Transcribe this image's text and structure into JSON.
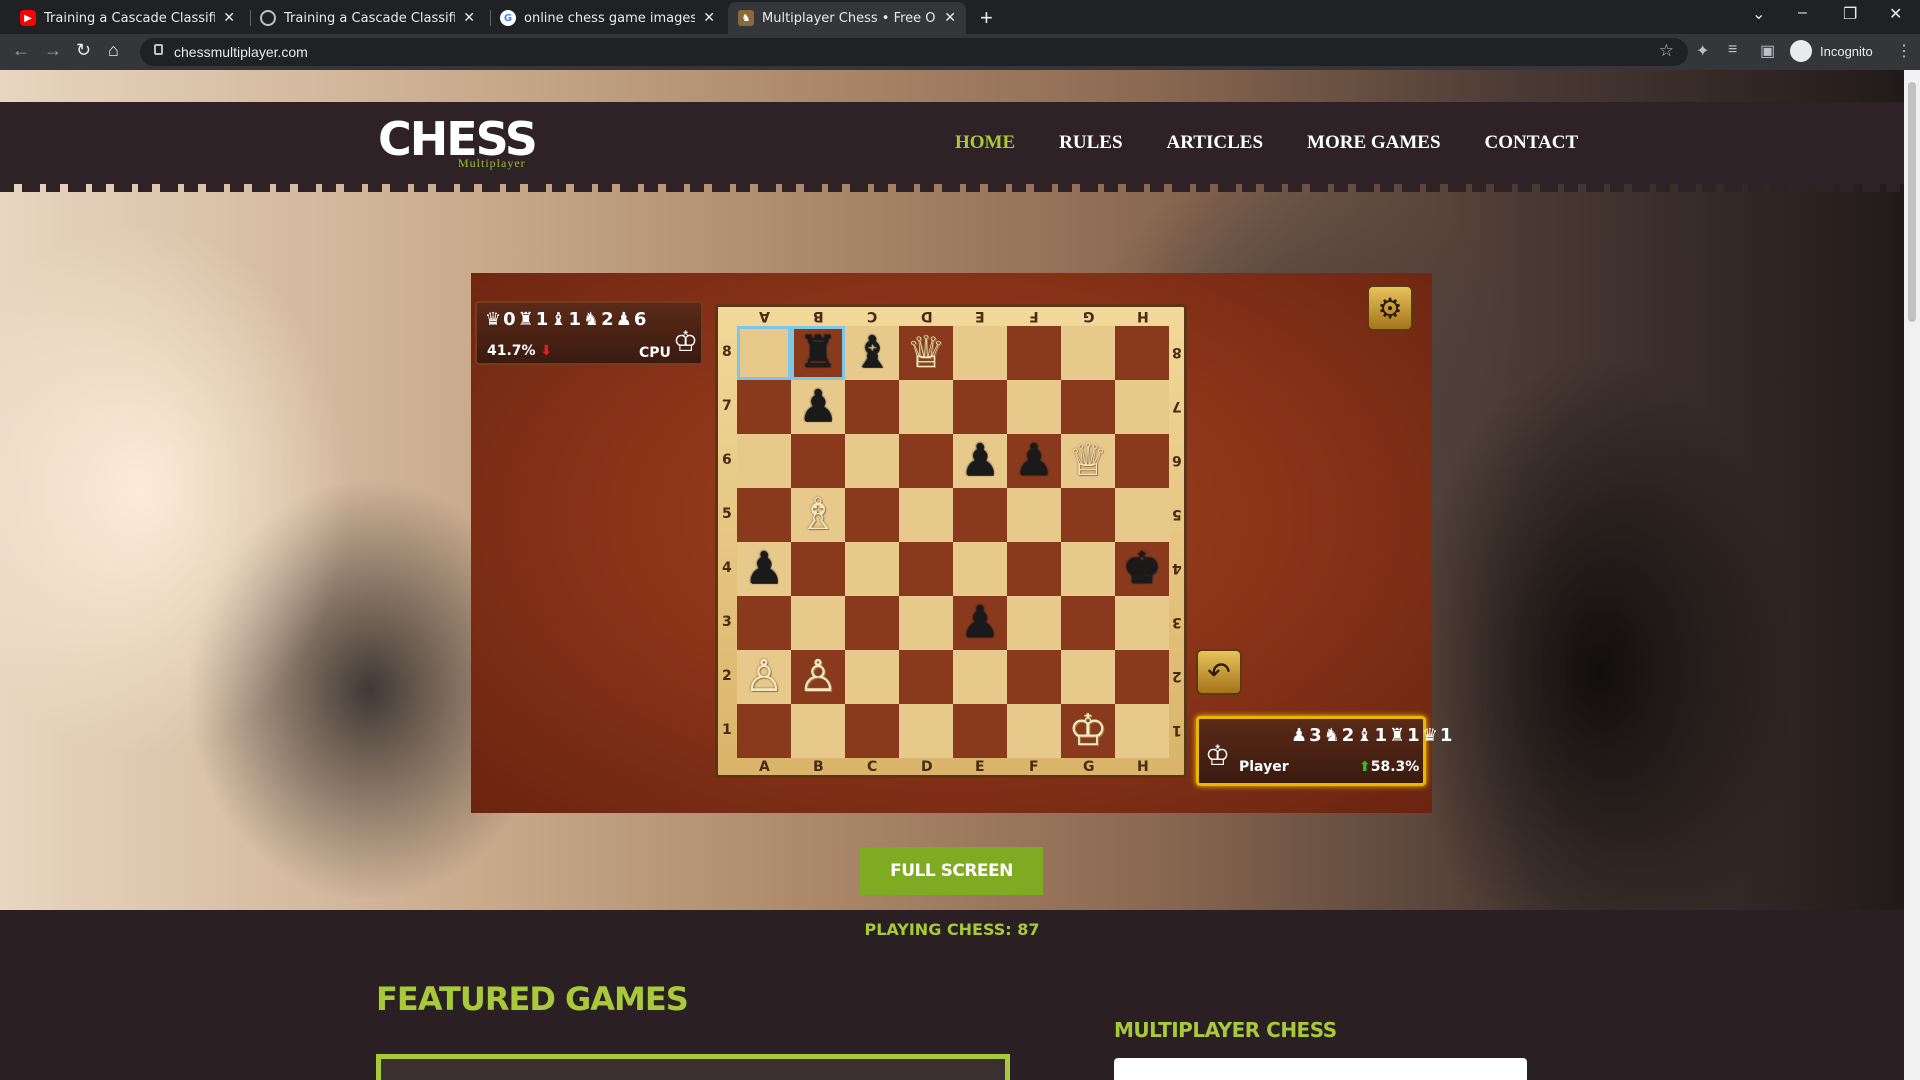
{
  "browser": {
    "tabs": [
      {
        "title": "Training a Cascade Classifier - Op",
        "icon": "youtube-icon"
      },
      {
        "title": "Training a Cascade Classifier - Le",
        "icon": "globe-icon"
      },
      {
        "title": "online chess game images - Goo",
        "icon": "google-icon"
      },
      {
        "title": "Multiplayer Chess • Free Online C",
        "icon": "chess-icon"
      }
    ],
    "url": "chessmultiplayer.com",
    "profile_label": "Incognito"
  },
  "site": {
    "logo_main": "CHESS",
    "logo_sub": "Multiplayer",
    "nav": [
      "HOME",
      "RULES",
      "ARTICLES",
      "MORE GAMES",
      "CONTACT"
    ],
    "fullscreen_label": "FULL SCREEN",
    "playing_label": "PLAYING CHESS: 87",
    "featured_title": "FEATURED GAMES",
    "multiplayer_title": "MULTIPLAYER CHESS"
  },
  "game": {
    "cpu": {
      "name": "CPU",
      "percent": "41.7%",
      "captured": [
        "♛0",
        "♜1",
        "♝1",
        "♞2",
        "♟6"
      ]
    },
    "player": {
      "name": "Player",
      "percent": "58.3%",
      "captured": [
        "♟3",
        "♞2",
        "♝1",
        "♜1",
        "♛1"
      ]
    },
    "files": [
      "A",
      "B",
      "C",
      "D",
      "E",
      "F",
      "G",
      "H"
    ],
    "ranks": [
      "8",
      "7",
      "6",
      "5",
      "4",
      "3",
      "2",
      "1"
    ],
    "board": [
      [
        "",
        "b♜",
        "b♝",
        "w♕",
        "",
        "",
        "",
        ""
      ],
      [
        "",
        "b♟",
        "",
        "",
        "",
        "",
        "",
        ""
      ],
      [
        "",
        "",
        "",
        "",
        "b♟",
        "b♟",
        "w♕",
        ""
      ],
      [
        "",
        "w♗",
        "",
        "",
        "",
        "",
        "",
        ""
      ],
      [
        "b♟",
        "",
        "",
        "",
        "",
        "",
        "",
        "b♚"
      ],
      [
        "",
        "",
        "",
        "",
        "b♟",
        "",
        "",
        ""
      ],
      [
        "w♙",
        "w♙",
        "",
        "",
        "",
        "",
        "",
        ""
      ],
      [
        "",
        "",
        "",
        "",
        "",
        "",
        "w♔",
        ""
      ]
    ],
    "highlight": [
      "a8",
      "b8"
    ],
    "colors": {
      "accent": "#a8c93a",
      "header": "#2f2226",
      "board_light": "#e7c98c",
      "board_dark": "#8a3a1c"
    }
  }
}
